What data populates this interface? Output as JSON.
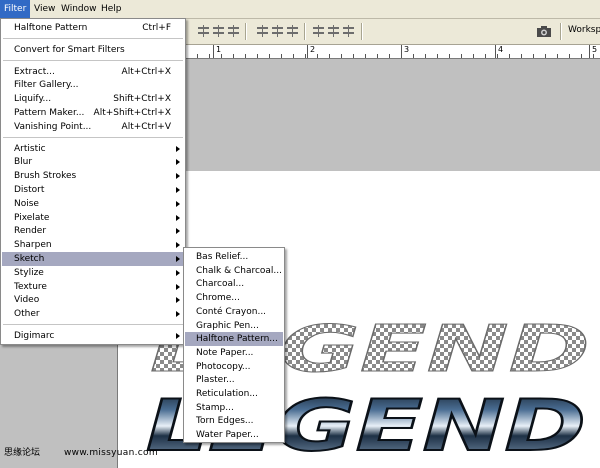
{
  "menubar": {
    "items": [
      {
        "label": "Filter",
        "active": true
      },
      {
        "label": "View",
        "active": false
      },
      {
        "label": "Window",
        "active": false
      },
      {
        "label": "Help",
        "active": false
      }
    ]
  },
  "options_bar": {
    "workspace_label": "Workspa",
    "workspace_icon": "camera-icon"
  },
  "ruler": {
    "labels": [
      "1",
      "2",
      "3",
      "4",
      "5"
    ]
  },
  "filter_menu": {
    "last_filter": {
      "label": "Halftone Pattern",
      "shortcut": "Ctrl+F"
    },
    "convert": {
      "label": "Convert for Smart Filters"
    },
    "tools": [
      {
        "label": "Extract...",
        "shortcut": "Alt+Ctrl+X"
      },
      {
        "label": "Filter Gallery...",
        "shortcut": ""
      },
      {
        "label": "Liquify...",
        "shortcut": "Shift+Ctrl+X"
      },
      {
        "label": "Pattern Maker...",
        "shortcut": "Alt+Shift+Ctrl+X"
      },
      {
        "label": "Vanishing Point...",
        "shortcut": "Alt+Ctrl+V"
      }
    ],
    "categories": [
      {
        "label": "Artistic"
      },
      {
        "label": "Blur"
      },
      {
        "label": "Brush Strokes"
      },
      {
        "label": "Distort"
      },
      {
        "label": "Noise"
      },
      {
        "label": "Pixelate"
      },
      {
        "label": "Render"
      },
      {
        "label": "Sharpen"
      },
      {
        "label": "Sketch",
        "highlighted": true
      },
      {
        "label": "Stylize"
      },
      {
        "label": "Texture"
      },
      {
        "label": "Video"
      },
      {
        "label": "Other"
      }
    ],
    "plugins": [
      {
        "label": "Digimarc"
      }
    ]
  },
  "sketch_menu": {
    "items": [
      {
        "label": "Bas Relief..."
      },
      {
        "label": "Chalk & Charcoal..."
      },
      {
        "label": "Charcoal..."
      },
      {
        "label": "Chrome..."
      },
      {
        "label": "Conté Crayon..."
      },
      {
        "label": "Graphic Pen..."
      },
      {
        "label": "Halftone Pattern...",
        "highlighted": true
      },
      {
        "label": "Note Paper..."
      },
      {
        "label": "Photocopy..."
      },
      {
        "label": "Plaster..."
      },
      {
        "label": "Reticulation..."
      },
      {
        "label": "Stamp..."
      },
      {
        "label": "Torn Edges..."
      },
      {
        "label": "Water Paper..."
      }
    ]
  },
  "artwork": {
    "text_top": "LEGEND",
    "text_bottom": "LEGEND"
  },
  "watermark": {
    "left": "思缘论坛",
    "right": "www.missyuan.com"
  },
  "colors": {
    "menu_highlight": "#a5a8c0",
    "menubar_active": "#316ac5",
    "chrome_bg": "#ece9d8",
    "canvas_grey": "#c0c0c0"
  }
}
